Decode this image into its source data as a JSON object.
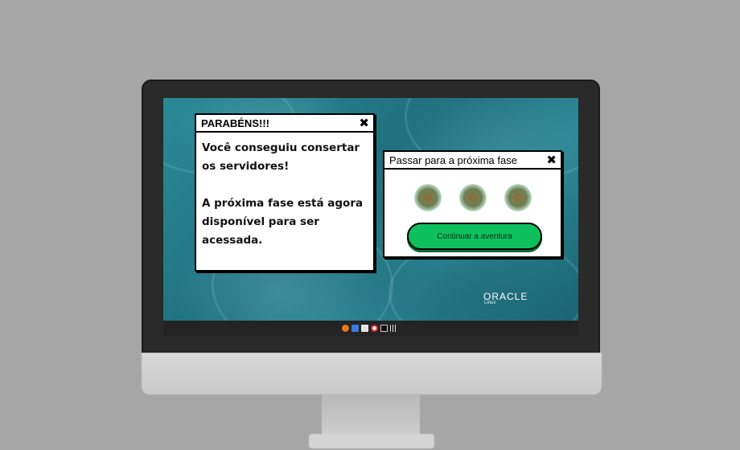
{
  "dialog_success": {
    "title": "PARABÉNS!!!",
    "line1": "Você conseguiu consertar os servidores!",
    "line2": "A próxima fase está agora disponível para ser acessada.",
    "close_glyph": "✖"
  },
  "dialog_next": {
    "title": "Passar para a próxima fase",
    "close_glyph": "✖",
    "button_label": "Continuar a aventura",
    "gems": [
      "gem-1",
      "gem-2",
      "gem-3"
    ]
  },
  "desktop": {
    "brand": "ORACLE",
    "brand_sub": "Linux"
  },
  "taskbar": {
    "icons": [
      "firefox-icon",
      "files-icon",
      "camera-icon",
      "help-icon",
      "terminal-icon",
      "menu-icon"
    ]
  },
  "colors": {
    "accent_button": "#0ec05c",
    "wallpaper": "#1f6f7e"
  }
}
